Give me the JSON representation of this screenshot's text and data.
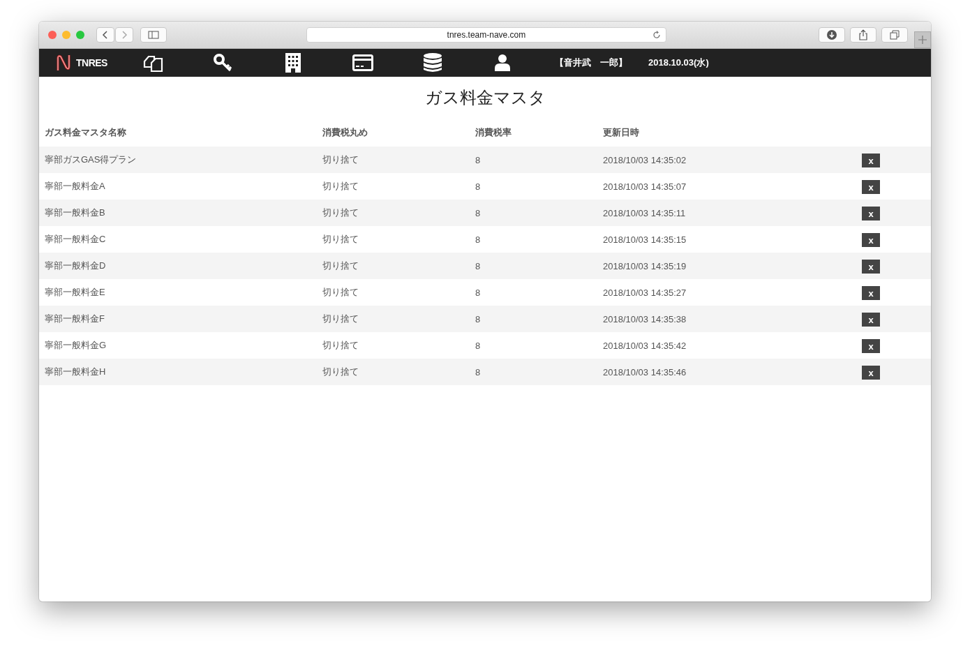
{
  "browser": {
    "url": "tnres.team-nave.com"
  },
  "nav": {
    "logo": "TNRES",
    "user": "【音井武　一郎】",
    "date": "2018.10.03(水)"
  },
  "page": {
    "title": "ガス料金マスタ"
  },
  "table": {
    "columns": [
      "ガス料金マスタ名称",
      "消費税丸め",
      "消費税率",
      "更新日時"
    ],
    "rows": [
      {
        "name": "寧部ガスGAS得プラン",
        "rounding": "切り捨て",
        "rate": "8",
        "updated": "2018/10/03 14:35:02",
        "delete": "x"
      },
      {
        "name": "寧部一般料金A",
        "rounding": "切り捨て",
        "rate": "8",
        "updated": "2018/10/03 14:35:07",
        "delete": "x"
      },
      {
        "name": "寧部一般料金B",
        "rounding": "切り捨て",
        "rate": "8",
        "updated": "2018/10/03 14:35:11",
        "delete": "x"
      },
      {
        "name": "寧部一般料金C",
        "rounding": "切り捨て",
        "rate": "8",
        "updated": "2018/10/03 14:35:15",
        "delete": "x"
      },
      {
        "name": "寧部一般料金D",
        "rounding": "切り捨て",
        "rate": "8",
        "updated": "2018/10/03 14:35:19",
        "delete": "x"
      },
      {
        "name": "寧部一般料金E",
        "rounding": "切り捨て",
        "rate": "8",
        "updated": "2018/10/03 14:35:27",
        "delete": "x"
      },
      {
        "name": "寧部一般料金F",
        "rounding": "切り捨て",
        "rate": "8",
        "updated": "2018/10/03 14:35:38",
        "delete": "x"
      },
      {
        "name": "寧部一般料金G",
        "rounding": "切り捨て",
        "rate": "8",
        "updated": "2018/10/03 14:35:42",
        "delete": "x"
      },
      {
        "name": "寧部一般料金H",
        "rounding": "切り捨て",
        "rate": "8",
        "updated": "2018/10/03 14:35:46",
        "delete": "x"
      }
    ]
  }
}
